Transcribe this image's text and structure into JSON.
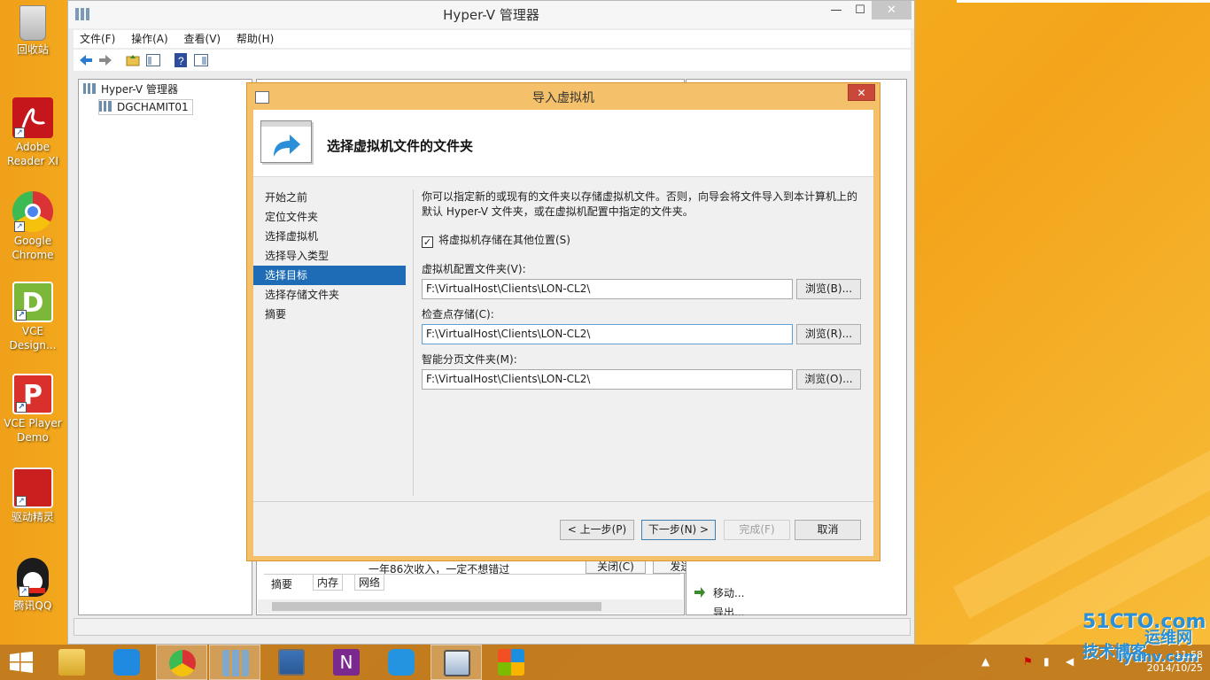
{
  "desktop": {
    "icons": [
      {
        "label": "回收站",
        "icon": "recycle-bin-icon"
      },
      {
        "label": "Adobe Reader XI",
        "icon": "adobe-reader-icon"
      },
      {
        "label": "Google Chrome",
        "icon": "chrome-icon"
      },
      {
        "label": "VCE Design...",
        "icon": "vce-designer-icon"
      },
      {
        "label": "VCE Player Demo",
        "icon": "vce-player-icon"
      },
      {
        "label": "驱动精灵",
        "icon": "driver-genius-icon"
      },
      {
        "label": "腾讯QQ",
        "icon": "qq-icon"
      }
    ]
  },
  "main_window": {
    "title": "Hyper-V 管理器",
    "controls": {
      "minimize": "—",
      "maximize": "☐",
      "close": "✕"
    },
    "menu": [
      "文件(F)",
      "操作(A)",
      "查看(V)",
      "帮助(H)"
    ],
    "tree": {
      "root": "Hyper-V 管理器",
      "server": "DGCHAMIT01"
    },
    "bottom_tabs": [
      "摘要",
      "内存",
      "网络"
    ],
    "behind_text": "一年86次收入，一定不想错过",
    "behind_buttons": [
      "关闭(C)",
      "发送(S)"
    ],
    "actions": [
      "移动...",
      "导出..."
    ]
  },
  "dialog": {
    "title": "导入虚拟机",
    "close": "✕",
    "heading": "选择虚拟机文件的文件夹",
    "steps": [
      "开始之前",
      "定位文件夹",
      "选择虚拟机",
      "选择导入类型",
      "选择目标",
      "选择存储文件夹",
      "摘要"
    ],
    "active_step": 4,
    "description": "你可以指定新的或现有的文件夹以存储虚拟机文件。否则，向导会将文件导入到本计算机上的默认 Hyper-V 文件夹，或在虚拟机配置中指定的文件夹。",
    "checkbox": {
      "label": "将虚拟机存储在其他位置(S)",
      "checked": true
    },
    "fields": [
      {
        "label": "虚拟机配置文件夹(V):",
        "value": "F:\\VirtualHost\\Clients\\LON-CL2\\",
        "button": "浏览(B)..."
      },
      {
        "label": "检查点存储(C):",
        "value": "F:\\VirtualHost\\Clients\\LON-CL2\\",
        "button": "浏览(R)..."
      },
      {
        "label": "智能分页文件夹(M):",
        "value": "F:\\VirtualHost\\Clients\\LON-CL2\\",
        "button": "浏览(O)..."
      }
    ],
    "buttons": {
      "prev": "< 上一步(P)",
      "next": "下一步(N) >",
      "finish": "完成(F)",
      "cancel": "取消"
    }
  },
  "taskbar": {
    "clock_time": "11:58",
    "clock_date": "2014/10/25",
    "watermark_a": "51CTO.com",
    "watermark_b": "技术博客",
    "watermark_c": "运维网",
    "watermark_d": "iyunv.com"
  },
  "colors": {
    "accent": "#1d6cb5",
    "dialog_frame": "#f4c06a",
    "close_red": "#c9483a"
  }
}
